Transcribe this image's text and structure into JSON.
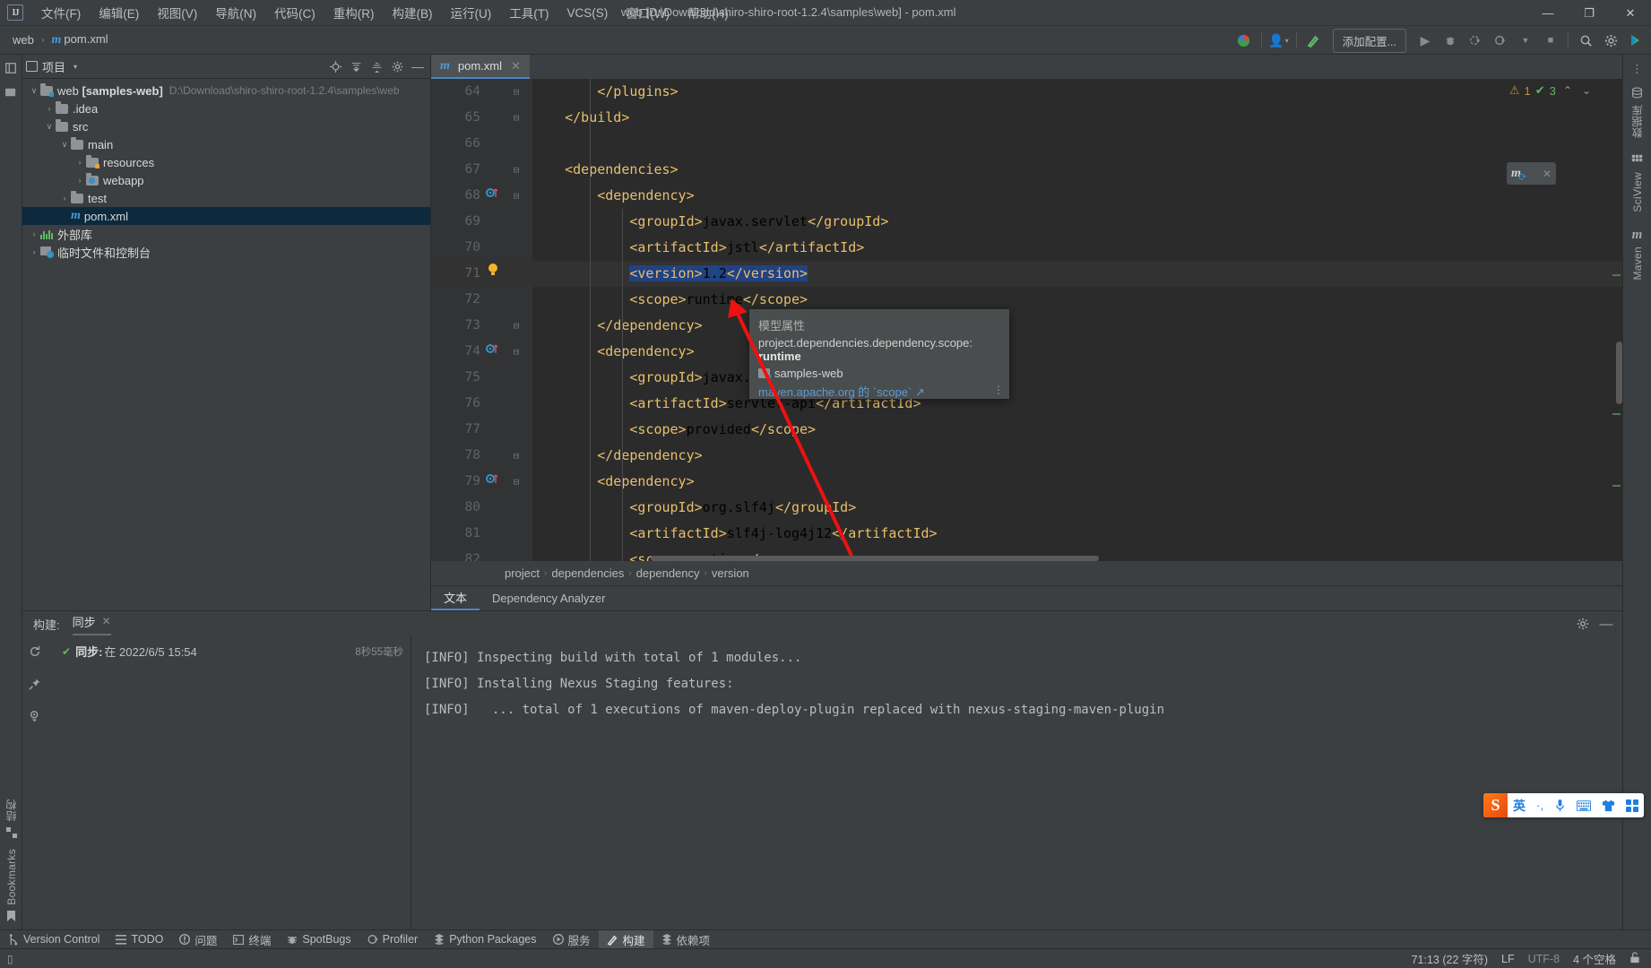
{
  "titlebar": {
    "logo": "IJ",
    "menus": [
      {
        "label": "文件(F)"
      },
      {
        "label": "编辑(E)"
      },
      {
        "label": "视图(V)"
      },
      {
        "label": "导航(N)"
      },
      {
        "label": "代码(C)"
      },
      {
        "label": "重构(R)"
      },
      {
        "label": "构建(B)"
      },
      {
        "label": "运行(U)"
      },
      {
        "label": "工具(T)"
      },
      {
        "label": "VCS(S)"
      },
      {
        "label": "窗口(W)"
      },
      {
        "label": "帮助(H)"
      }
    ],
    "window_title": "web [D:\\Download\\shiro-shiro-root-1.2.4\\samples\\web] - pom.xml",
    "minimize": "—",
    "maximize": "❐",
    "close": "✕"
  },
  "navbar": {
    "breadcrumb": [
      {
        "label": "web",
        "icon": ""
      },
      {
        "label": "pom.xml",
        "icon": "m"
      }
    ],
    "separator": "›",
    "add_config_label": "添加配置...",
    "icons": [
      {
        "name": "search-everywhere-icon",
        "glyph": "🔍"
      },
      {
        "name": "settings-icon",
        "glyph": "✿"
      },
      {
        "name": "updates-icon",
        "glyph": "▶"
      }
    ],
    "run_controls": [
      {
        "name": "run-button",
        "glyph": "▶"
      },
      {
        "name": "debug-button",
        "glyph": "🐞"
      },
      {
        "name": "run-with-coverage-button",
        "glyph": "▶"
      },
      {
        "name": "profile-button",
        "glyph": "◷"
      },
      {
        "name": "dropdown-caret",
        "glyph": "▾"
      },
      {
        "name": "stop-button",
        "glyph": "■"
      }
    ]
  },
  "left_strip": {
    "top_icons": [
      {
        "name": "project-tool-icon",
        "glyph": "▤"
      },
      {
        "name": "commit-tool-icon",
        "glyph": "▰"
      }
    ],
    "bottom_labels": [
      {
        "label": "结构",
        "icon": "▦"
      },
      {
        "label": "Bookmarks",
        "icon": "🔖"
      }
    ]
  },
  "project_panel": {
    "title": "项目",
    "caret": "▾",
    "actions": [
      {
        "name": "select-opened-file-icon",
        "glyph": "⊕"
      },
      {
        "name": "expand-all-icon",
        "glyph": "⇳"
      },
      {
        "name": "collapse-all-icon",
        "glyph": "⇲"
      },
      {
        "name": "panel-settings-icon",
        "glyph": "✿"
      },
      {
        "name": "hide-panel-icon",
        "glyph": "—"
      }
    ],
    "tree": [
      {
        "indent": 0,
        "arrow": "∨",
        "icon": "folder-module",
        "name": "web ",
        "bold": "[samples-web]",
        "path": "D:\\Download\\shiro-shiro-root-1.2.4\\samples\\web",
        "selected": false
      },
      {
        "indent": 1,
        "arrow": "›",
        "icon": "folder",
        "name": ".idea",
        "bold": "",
        "path": "",
        "selected": false
      },
      {
        "indent": 1,
        "arrow": "∨",
        "icon": "folder",
        "name": "src",
        "bold": "",
        "path": "",
        "selected": false
      },
      {
        "indent": 2,
        "arrow": "∨",
        "icon": "folder",
        "name": "main",
        "bold": "",
        "path": "",
        "selected": false
      },
      {
        "indent": 3,
        "arrow": "›",
        "icon": "folder-resources",
        "name": "resources",
        "bold": "",
        "path": "",
        "selected": false
      },
      {
        "indent": 3,
        "arrow": "›",
        "icon": "folder-webapp",
        "name": "webapp",
        "bold": "",
        "path": "",
        "selected": false
      },
      {
        "indent": 2,
        "arrow": "›",
        "icon": "folder",
        "name": "test",
        "bold": "",
        "path": "",
        "selected": false
      },
      {
        "indent": 2,
        "arrow": "",
        "icon": "maven",
        "name": "pom.xml",
        "bold": "",
        "path": "",
        "selected": true
      },
      {
        "indent": 0,
        "arrow": "›",
        "icon": "library",
        "name": "外部库",
        "bold": "",
        "path": "",
        "selected": false
      },
      {
        "indent": 0,
        "arrow": "›",
        "icon": "scratch",
        "name": "临时文件和控制台",
        "bold": "",
        "path": "",
        "selected": false
      }
    ]
  },
  "editor": {
    "tab": {
      "label": "pom.xml",
      "icon": "m",
      "close": "✕"
    },
    "inspection": {
      "warning_count": "1",
      "warning_icon": "⚠",
      "ok_count": "3",
      "ok_icon": "✔",
      "up": "⌃",
      "down": "⌄"
    },
    "maven_chip": {
      "icon": "m",
      "reload": "⟳",
      "close": "✕"
    },
    "lines": [
      {
        "num": "64",
        "fold": "⊟",
        "text": "        </plugins>",
        "gutter": ""
      },
      {
        "num": "65",
        "fold": "⊟",
        "text": "    </build>",
        "gutter": ""
      },
      {
        "num": "66",
        "fold": "",
        "text": "",
        "gutter": ""
      },
      {
        "num": "67",
        "fold": "⊟",
        "text": "    <dependencies>",
        "gutter": ""
      },
      {
        "num": "68",
        "fold": "⊟",
        "text": "        <dependency>",
        "gutter": "maven-nav"
      },
      {
        "num": "69",
        "fold": "",
        "text": "            <groupId>javax.servlet</groupId>",
        "gutter": ""
      },
      {
        "num": "70",
        "fold": "",
        "text": "            <artifactId>jstl</artifactId>",
        "gutter": ""
      },
      {
        "num": "71",
        "fold": "",
        "text": "            <version>1.2</version>",
        "gutter": "bulb",
        "selected": true,
        "current": true
      },
      {
        "num": "72",
        "fold": "",
        "text": "            <scope>runtime</scope>",
        "gutter": ""
      },
      {
        "num": "73",
        "fold": "⊟",
        "text": "        </dependency>",
        "gutter": ""
      },
      {
        "num": "74",
        "fold": "⊟",
        "text": "        <dependency>",
        "gutter": "maven-nav"
      },
      {
        "num": "75",
        "fold": "",
        "text": "            <groupId>javax.servlet</groupId>",
        "gutter": ""
      },
      {
        "num": "76",
        "fold": "",
        "text": "            <artifactId>servlet-api</artifactId>",
        "gutter": ""
      },
      {
        "num": "77",
        "fold": "",
        "text": "            <scope>provided</scope>",
        "gutter": ""
      },
      {
        "num": "78",
        "fold": "⊟",
        "text": "        </dependency>",
        "gutter": ""
      },
      {
        "num": "79",
        "fold": "⊟",
        "text": "        <dependency>",
        "gutter": "maven-nav"
      },
      {
        "num": "80",
        "fold": "",
        "text": "            <groupId>org.slf4j</groupId>",
        "gutter": ""
      },
      {
        "num": "81",
        "fold": "",
        "text": "            <artifactId>slf4j-log4j12</artifactId>",
        "gutter": ""
      },
      {
        "num": "82",
        "fold": "",
        "text": "            <scope>runtime</scope>",
        "gutter": ""
      }
    ],
    "xml_breadcrumb": [
      "project",
      "dependencies",
      "dependency",
      "version"
    ],
    "xml_breadcrumb_sep": "›",
    "bottom_tabs": [
      {
        "label": "文本",
        "active": true
      },
      {
        "label": "Dependency Analyzer",
        "active": false
      }
    ]
  },
  "tooltip": {
    "heading": "模型属性",
    "property": "project.dependencies.dependency.scope:",
    "value": "runtime",
    "module": "samples-web",
    "link": "maven.apache.org 的 `scope`",
    "link_arrow": "↗",
    "more": "⋮"
  },
  "build_panel": {
    "label": "构建:",
    "tab": {
      "label": "同步",
      "close": "✕"
    },
    "actions": [
      {
        "name": "build-settings-icon",
        "glyph": "✿"
      },
      {
        "name": "hide-build-panel-icon",
        "glyph": "—"
      }
    ],
    "side_icons": [
      {
        "name": "rerun-icon",
        "glyph": "⟳"
      },
      {
        "name": "pin-icon",
        "glyph": "📌"
      },
      {
        "name": "filter-icon",
        "glyph": "◉"
      }
    ],
    "tree_row": {
      "check": "✔",
      "bold": "同步:",
      "text": "在 2022/6/5 15:54",
      "duration": "8秒55毫秒"
    },
    "console_lines": [
      "[INFO] Inspecting build with total of 1 modules...",
      "[INFO] Installing Nexus Staging features:",
      "[INFO]   ... total of 1 executions of maven-deploy-plugin replaced with nexus-staging-maven-plugin"
    ]
  },
  "right_strip": {
    "items": [
      {
        "label": "数据库",
        "icon": "◎"
      },
      {
        "label": "SciView",
        "icon": "▦"
      },
      {
        "label": "Maven",
        "icon": "m"
      }
    ],
    "notifications_icon": "⋮"
  },
  "tool_window_bar": {
    "items": [
      {
        "label": "Version Control",
        "icon": "⑂",
        "active": false
      },
      {
        "label": "TODO",
        "icon": "☰",
        "active": false
      },
      {
        "label": "问题",
        "icon": "❶",
        "active": false
      },
      {
        "label": "终端",
        "icon": "▣",
        "active": false
      },
      {
        "label": "SpotBugs",
        "icon": "🐞",
        "active": false
      },
      {
        "label": "Profiler",
        "icon": "◷",
        "active": false
      },
      {
        "label": "Python Packages",
        "icon": "❅",
        "active": false
      },
      {
        "label": "服务",
        "icon": "◑",
        "active": false
      },
      {
        "label": "构建",
        "icon": "⌁",
        "active": true
      },
      {
        "label": "依赖项",
        "icon": "❅",
        "active": false
      }
    ]
  },
  "statusbar": {
    "left_icon": "▯",
    "caret_position": "71:13 (22 字符)",
    "line_separator": "LF",
    "encoding": "UTF-8",
    "indent": "4 个空格",
    "lock_icon": "🔓"
  },
  "ime": {
    "logo": "S",
    "items": [
      {
        "name": "ime-mode-label",
        "glyph": "英"
      },
      {
        "name": "ime-punctuation-icon",
        "glyph": "·,"
      },
      {
        "name": "ime-voice-icon",
        "glyph": "🎤"
      },
      {
        "name": "ime-keyboard-icon",
        "glyph": "⌨"
      },
      {
        "name": "ime-skin-icon",
        "glyph": "👕"
      },
      {
        "name": "ime-toolbox-icon",
        "glyph": "⊞"
      }
    ]
  },
  "colors": {
    "bg": "#3c3f41",
    "editor_bg": "#2b2b2b",
    "accent": "#4a88c7",
    "tag": "#e8bf6a",
    "value": "#a9b7c6",
    "selection": "#214283",
    "link": "#5b9bd5"
  }
}
